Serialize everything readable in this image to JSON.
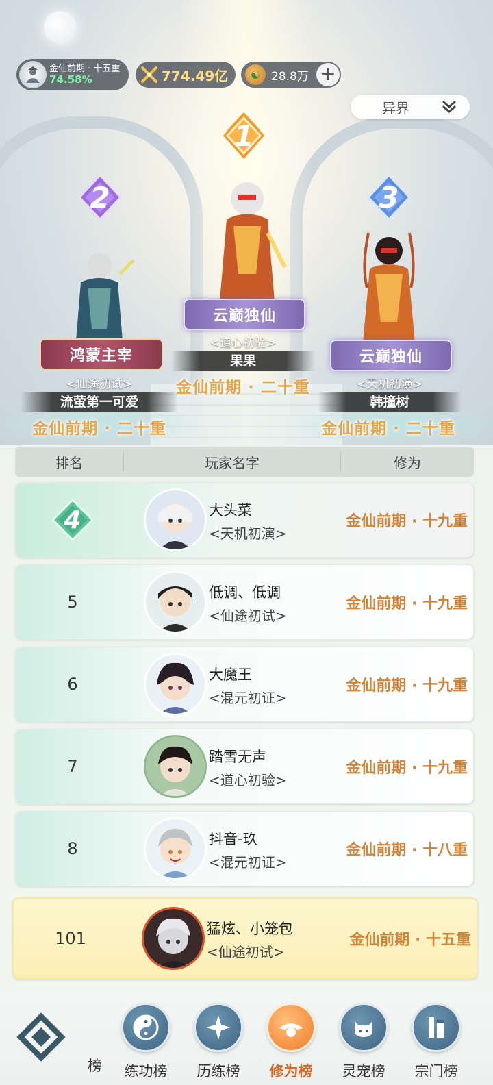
{
  "status": {
    "realm_name": "金仙前期 · 十五重",
    "realm_progress": "74.58%",
    "power": "774.49亿",
    "currency": "28.8万"
  },
  "server_select": {
    "value": "异界"
  },
  "podium": {
    "first": {
      "rank": "1",
      "title_plate": "云巅独仙",
      "title_tag": "<道心初验>",
      "player": "果果",
      "level": "金仙前期 · 二十重"
    },
    "second": {
      "rank": "2",
      "title_plate": "鸿蒙主宰",
      "title_tag": "<仙途初试>",
      "player": "流萤第一可爱",
      "level": "金仙前期 · 二十重"
    },
    "third": {
      "rank": "3",
      "title_plate": "云巅独仙",
      "title_tag": "<天机初演>",
      "player": "韩撞树",
      "level": "金仙前期 · 二十重"
    }
  },
  "table": {
    "headers": {
      "rank": "排名",
      "name": "玩家名字",
      "level": "修为"
    },
    "rows": [
      {
        "rank": "4",
        "name": "大头菜",
        "title": "<天机初演>",
        "level": "金仙前期 · 十九重"
      },
      {
        "rank": "5",
        "name": "低调、低调",
        "title": "<仙途初试>",
        "level": "金仙前期 · 十九重"
      },
      {
        "rank": "6",
        "name": "大魔王",
        "title": "<混元初证>",
        "level": "金仙前期 · 十九重"
      },
      {
        "rank": "7",
        "name": "踏雪无声",
        "title": "<道心初验>",
        "level": "金仙前期 · 十九重"
      },
      {
        "rank": "8",
        "name": "抖音-玖",
        "title": "<混元初证>",
        "level": "金仙前期 · 十八重"
      }
    ],
    "my_row": {
      "rank": "101",
      "name": "猛炫、小笼包",
      "title": "<仙途初试>",
      "level": "金仙前期 · 十五重"
    }
  },
  "bottom_nav": {
    "left_partial": "榜",
    "items": [
      {
        "label": "练功榜",
        "icon": "yin-yang-icon"
      },
      {
        "label": "历练榜",
        "icon": "compass-star-icon"
      },
      {
        "label": "修为榜",
        "icon": "sage-hat-icon",
        "active": true
      },
      {
        "label": "灵宠榜",
        "icon": "pet-cat-icon"
      },
      {
        "label": "宗门榜",
        "icon": "sect-banner-icon"
      }
    ]
  },
  "colors": {
    "accent_orange": "#d0853a",
    "active_tab": "#d76a26",
    "progress_green": "#7df0a3",
    "power_gold": "#ffe08a"
  }
}
